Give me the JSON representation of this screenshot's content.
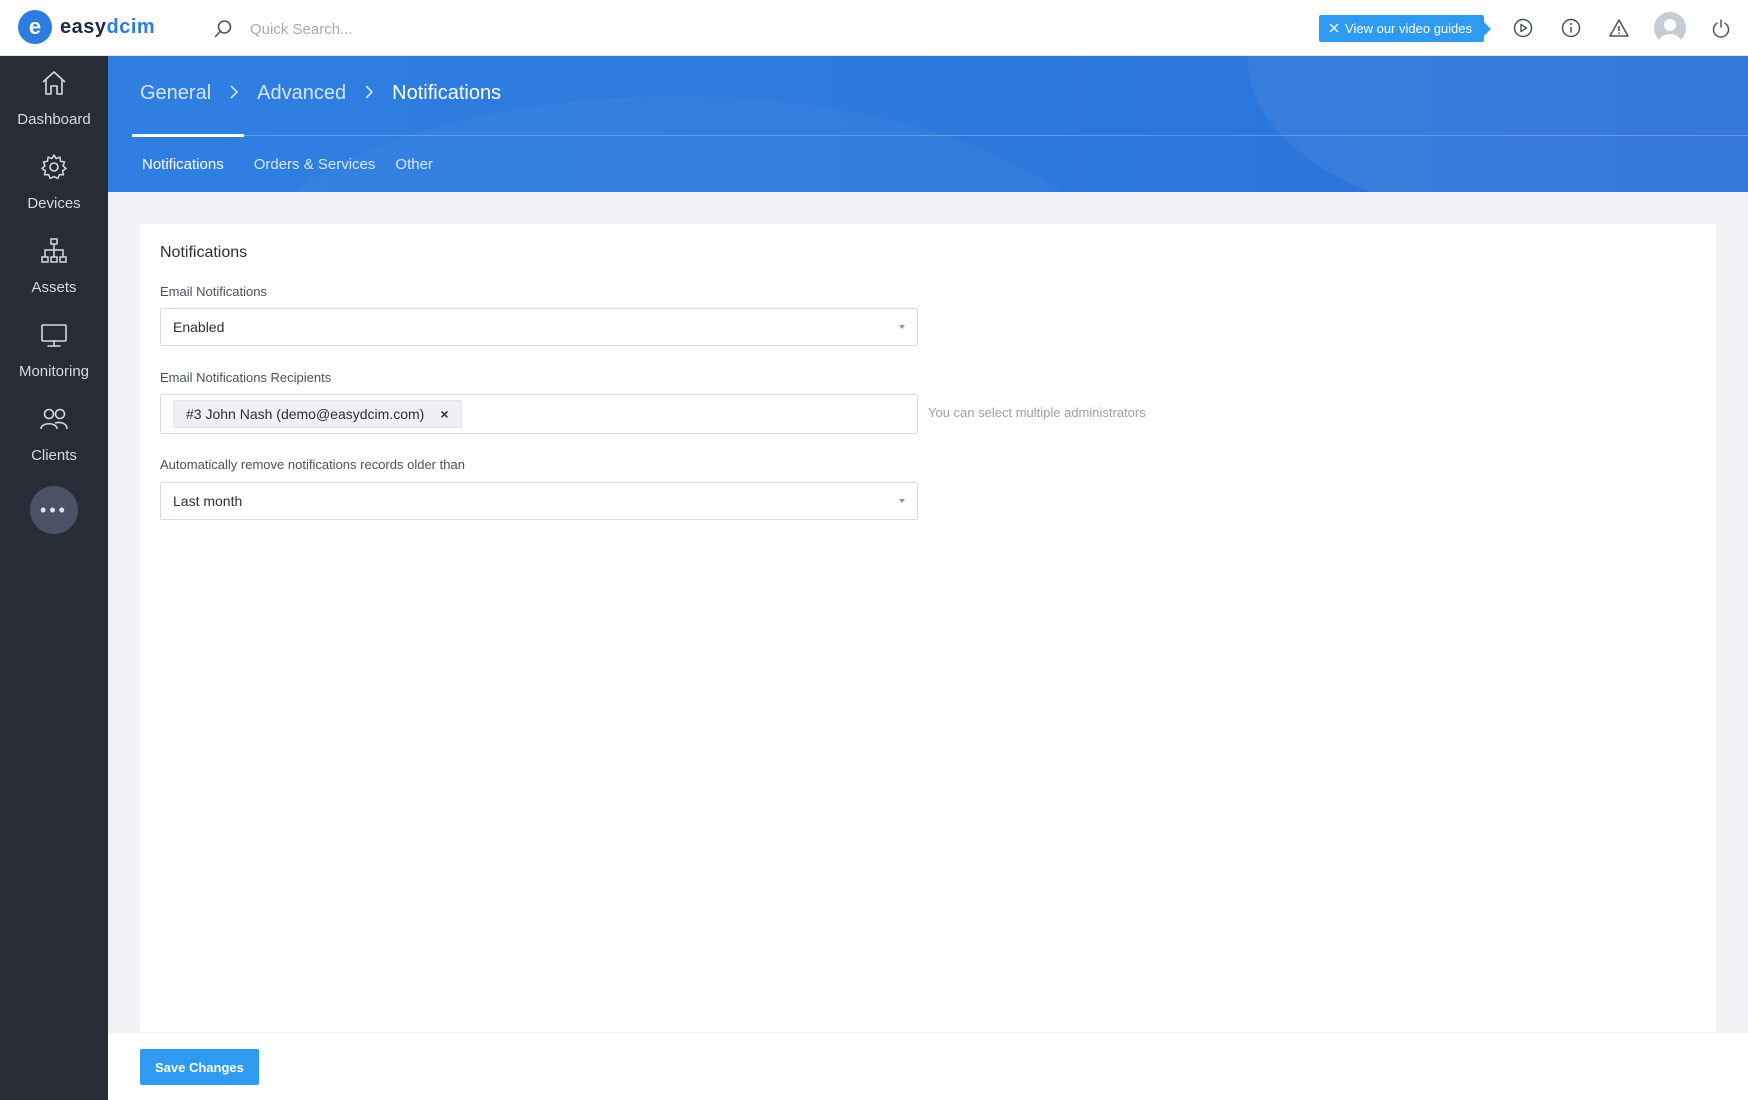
{
  "brand": {
    "mark": "e",
    "name_prefix": "easy",
    "name_suffix": "dcim"
  },
  "search": {
    "placeholder": "Quick Search..."
  },
  "topbar": {
    "guide_button": "View our video guides"
  },
  "sidebar": {
    "items": [
      {
        "label": "Dashboard",
        "icon": "home-icon"
      },
      {
        "label": "Devices",
        "icon": "gear-icon"
      },
      {
        "label": "Assets",
        "icon": "sitemap-icon"
      },
      {
        "label": "Monitoring",
        "icon": "monitor-icon"
      },
      {
        "label": "Clients",
        "icon": "users-icon"
      }
    ],
    "more": "•••"
  },
  "breadcrumb": [
    "General",
    "Advanced",
    "Notifications"
  ],
  "tabs": [
    "Notifications",
    "Orders & Services",
    "Other"
  ],
  "form": {
    "title": "Notifications",
    "email_notifications": {
      "label": "Email Notifications",
      "value": "Enabled"
    },
    "recipients": {
      "label": "Email Notifications Recipients",
      "tag": "#3 John Nash (demo@easydcim.com)",
      "remove": "×",
      "help": "You can select multiple administrators"
    },
    "auto_remove": {
      "label": "Automatically remove notifications records older than",
      "value": "Last month"
    }
  },
  "footer": {
    "save_label": "Save Changes"
  },
  "colors": {
    "accent": "#2e9bf0",
    "band": "#2d78dd",
    "sidebar": "#282c37"
  }
}
